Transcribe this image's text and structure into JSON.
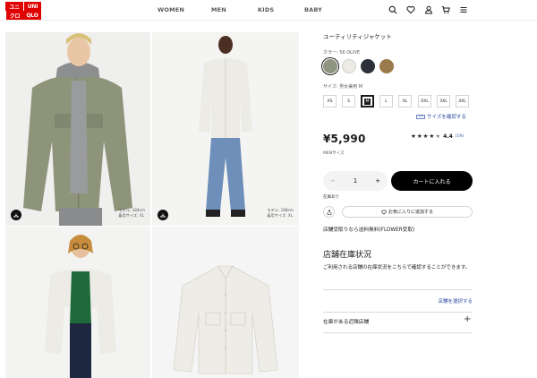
{
  "header": {
    "logo_top": "UNI",
    "logo_bottom": "QLO",
    "logo_top_jp": "ユニ",
    "logo_bottom_jp": "クロ",
    "nav": [
      "WOMEN",
      "MEN",
      "KIDS",
      "BABY"
    ],
    "icons": [
      "search-icon",
      "heart-icon",
      "user-icon",
      "cart-icon",
      "menu-icon"
    ]
  },
  "gallery": {
    "photo1_note": [
      "モデル: 184cm",
      "着用サイズ: XL"
    ],
    "photo2_note": [
      "モデル: 188cm",
      "着用サイズ: XL"
    ]
  },
  "product": {
    "name": "ユーティリティジャケット",
    "color_label": "カラー: 56 OLIVE",
    "colors": [
      {
        "name": "olive",
        "hex": "#8f9580",
        "selected": true
      },
      {
        "name": "off-white",
        "hex": "#ece9e1",
        "selected": false
      },
      {
        "name": "navy",
        "hex": "#2b3039",
        "selected": false
      },
      {
        "name": "brown",
        "hex": "#9a7a4c",
        "selected": false
      }
    ],
    "size_label": "サイズ: 男女兼用 M",
    "sizes": [
      "XS",
      "S",
      "M",
      "L",
      "XL",
      "XXL",
      "3XL",
      "4XL"
    ],
    "selected_size": "M",
    "size_link": "サイズを確認する",
    "price": "¥5,990",
    "rating_value": "4.4",
    "rating_count": "(19)",
    "rating_stars": 4.4,
    "tax_note": "MENサイズ",
    "quantity": "1",
    "minus": "−",
    "plus": "+",
    "add_to_cart": "カートに入れる",
    "stock_note": "在庫あり",
    "favorite": "お気に入りに追加する",
    "pickup": "店舗受取りなら送料無料(FLOWER受取)",
    "inventory_title": "店舗在庫状況",
    "inventory_desc": "ご利用される店舗の在庫状況をこちらで確認することができます。",
    "select_store": "店舗を選択する",
    "nearby": "在庫がある近隣店舗",
    "expand": "+"
  },
  "colors": {
    "brand_red": "#e10000",
    "link_blue": "#2f4fa2",
    "cart_black": "#000000"
  }
}
